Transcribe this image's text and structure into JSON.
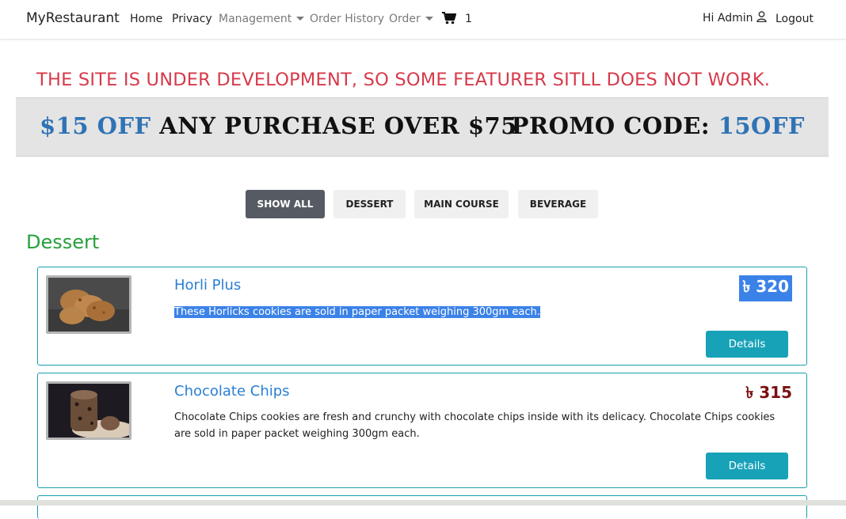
{
  "nav": {
    "brand": "MyRestaurant",
    "home": "Home",
    "privacy": "Privacy",
    "management": "Management",
    "order_history": "Order History",
    "order": "Order",
    "cart_count": "1",
    "greeting": "Hi Admin",
    "logout": "Logout"
  },
  "banner": {
    "message": "THE SITE IS UNDER DEVELOPMENT, SO SOME FEATURER SITLL DOES NOT WORK."
  },
  "promo": {
    "amount": "$15 OFF",
    "text": "ANY PURCHASE OVER $75",
    "code_label": "PROMO CODE:",
    "code": "15OFF"
  },
  "filters": [
    "SHOW ALL",
    "DESSERT",
    "MAIN COURSE",
    "BEVERAGE"
  ],
  "section": {
    "title": "Dessert"
  },
  "items": [
    {
      "name": "Horli Plus",
      "price": "৳ 320",
      "description": "These Horlicks cookies are sold in paper packet weighing 300gm each.",
      "button": "Details"
    },
    {
      "name": "Chocolate Chips",
      "price": "৳ 315",
      "description": "Chocolate Chips cookies are fresh and crunchy with chocolate chips inside with its delicacy. Chocolate Chips cookies are sold in paper packet weighing 300gm each.",
      "button": "Details"
    }
  ],
  "colors": {
    "accent": "#17a2b8",
    "banner_red": "#d63a4a",
    "section_green": "#27a03c",
    "link_blue": "#2a7fd4",
    "price": "#7b1010"
  }
}
